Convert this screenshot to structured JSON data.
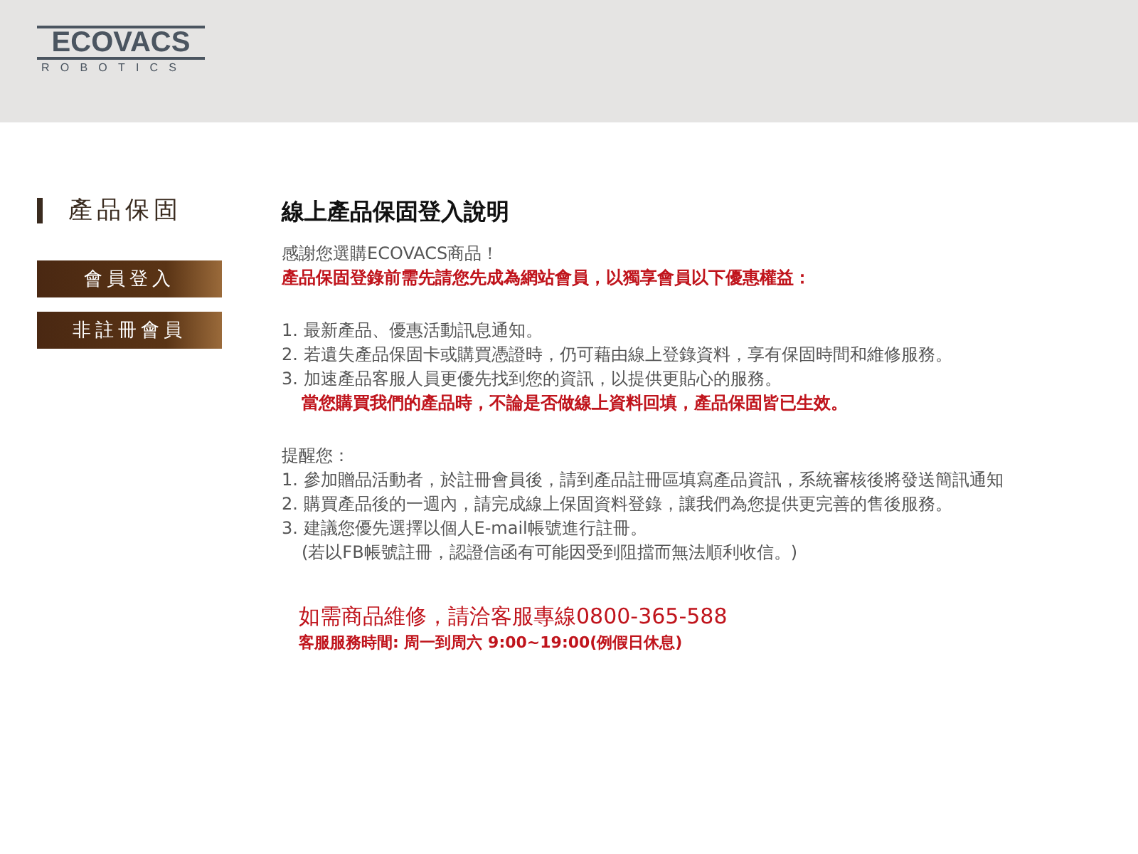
{
  "header": {
    "logo_top": "ECOVACS",
    "logo_bottom": "ROBOTICS"
  },
  "sidebar": {
    "title": "產品保固",
    "buttons": [
      {
        "label": "會員登入"
      },
      {
        "label": "非註冊會員"
      }
    ]
  },
  "content": {
    "title": "線上產品保固登入說明",
    "sections": [
      {
        "lines": [
          {
            "kind": "plain",
            "text": "感謝您選購ECOVACS商品！"
          },
          {
            "kind": "alert",
            "text": "產品保固登錄前需先請您先成為網站會員，以獨享會員以下優惠權益："
          }
        ]
      },
      {
        "lines": [
          {
            "kind": "plain",
            "text": "1. 最新產品、優惠活動訊息通知。"
          },
          {
            "kind": "plain",
            "text": "2. 若遺失產品保固卡或購買憑證時，仍可藉由線上登錄資料，享有保固時間和維修服務。"
          },
          {
            "kind": "plain",
            "text": "3. 加速產品客服人員更優先找到您的資訊，以提供更貼心的服務。"
          },
          {
            "kind": "indent-alert",
            "text": "當您購買我們的產品時，不論是否做線上資料回填，產品保固皆已生效。"
          }
        ]
      },
      {
        "lines": [
          {
            "kind": "plain",
            "text": "提醒您："
          },
          {
            "kind": "plain",
            "text": "1. 參加贈品活動者，於註冊會員後，請到產品註冊區填寫產品資訊，系統審核後將發送簡訊通知"
          },
          {
            "kind": "plain",
            "text": "2. 購買產品後的一週內，請完成線上保固資料登錄，讓我們為您提供更完善的售後服務。"
          },
          {
            "kind": "plain",
            "text": "3. 建議您優先選擇以個人E-mail帳號進行註冊。"
          },
          {
            "kind": "indent",
            "text": "(若以FB帳號註冊，認證信函有可能因受到阻擋而無法順利收信。)"
          }
        ]
      },
      {
        "lines": [
          {
            "kind": "hotline",
            "text": "如需商品維修，請洽客服專線0800-365-588"
          },
          {
            "kind": "hours",
            "text": "客服服務時間: 周一到周六 9:00~19:00(例假日休息)"
          }
        ]
      }
    ]
  }
}
